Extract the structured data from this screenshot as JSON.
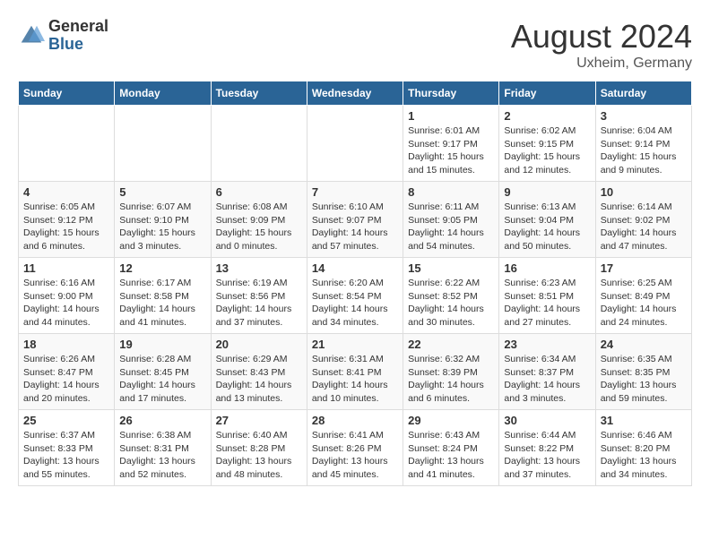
{
  "header": {
    "logo_general": "General",
    "logo_blue": "Blue",
    "month_year": "August 2024",
    "location": "Uxheim, Germany"
  },
  "days_of_week": [
    "Sunday",
    "Monday",
    "Tuesday",
    "Wednesday",
    "Thursday",
    "Friday",
    "Saturday"
  ],
  "weeks": [
    [
      {
        "day": "",
        "info": ""
      },
      {
        "day": "",
        "info": ""
      },
      {
        "day": "",
        "info": ""
      },
      {
        "day": "",
        "info": ""
      },
      {
        "day": "1",
        "info": "Sunrise: 6:01 AM\nSunset: 9:17 PM\nDaylight: 15 hours and 15 minutes."
      },
      {
        "day": "2",
        "info": "Sunrise: 6:02 AM\nSunset: 9:15 PM\nDaylight: 15 hours and 12 minutes."
      },
      {
        "day": "3",
        "info": "Sunrise: 6:04 AM\nSunset: 9:14 PM\nDaylight: 15 hours and 9 minutes."
      }
    ],
    [
      {
        "day": "4",
        "info": "Sunrise: 6:05 AM\nSunset: 9:12 PM\nDaylight: 15 hours and 6 minutes."
      },
      {
        "day": "5",
        "info": "Sunrise: 6:07 AM\nSunset: 9:10 PM\nDaylight: 15 hours and 3 minutes."
      },
      {
        "day": "6",
        "info": "Sunrise: 6:08 AM\nSunset: 9:09 PM\nDaylight: 15 hours and 0 minutes."
      },
      {
        "day": "7",
        "info": "Sunrise: 6:10 AM\nSunset: 9:07 PM\nDaylight: 14 hours and 57 minutes."
      },
      {
        "day": "8",
        "info": "Sunrise: 6:11 AM\nSunset: 9:05 PM\nDaylight: 14 hours and 54 minutes."
      },
      {
        "day": "9",
        "info": "Sunrise: 6:13 AM\nSunset: 9:04 PM\nDaylight: 14 hours and 50 minutes."
      },
      {
        "day": "10",
        "info": "Sunrise: 6:14 AM\nSunset: 9:02 PM\nDaylight: 14 hours and 47 minutes."
      }
    ],
    [
      {
        "day": "11",
        "info": "Sunrise: 6:16 AM\nSunset: 9:00 PM\nDaylight: 14 hours and 44 minutes."
      },
      {
        "day": "12",
        "info": "Sunrise: 6:17 AM\nSunset: 8:58 PM\nDaylight: 14 hours and 41 minutes."
      },
      {
        "day": "13",
        "info": "Sunrise: 6:19 AM\nSunset: 8:56 PM\nDaylight: 14 hours and 37 minutes."
      },
      {
        "day": "14",
        "info": "Sunrise: 6:20 AM\nSunset: 8:54 PM\nDaylight: 14 hours and 34 minutes."
      },
      {
        "day": "15",
        "info": "Sunrise: 6:22 AM\nSunset: 8:52 PM\nDaylight: 14 hours and 30 minutes."
      },
      {
        "day": "16",
        "info": "Sunrise: 6:23 AM\nSunset: 8:51 PM\nDaylight: 14 hours and 27 minutes."
      },
      {
        "day": "17",
        "info": "Sunrise: 6:25 AM\nSunset: 8:49 PM\nDaylight: 14 hours and 24 minutes."
      }
    ],
    [
      {
        "day": "18",
        "info": "Sunrise: 6:26 AM\nSunset: 8:47 PM\nDaylight: 14 hours and 20 minutes."
      },
      {
        "day": "19",
        "info": "Sunrise: 6:28 AM\nSunset: 8:45 PM\nDaylight: 14 hours and 17 minutes."
      },
      {
        "day": "20",
        "info": "Sunrise: 6:29 AM\nSunset: 8:43 PM\nDaylight: 14 hours and 13 minutes."
      },
      {
        "day": "21",
        "info": "Sunrise: 6:31 AM\nSunset: 8:41 PM\nDaylight: 14 hours and 10 minutes."
      },
      {
        "day": "22",
        "info": "Sunrise: 6:32 AM\nSunset: 8:39 PM\nDaylight: 14 hours and 6 minutes."
      },
      {
        "day": "23",
        "info": "Sunrise: 6:34 AM\nSunset: 8:37 PM\nDaylight: 14 hours and 3 minutes."
      },
      {
        "day": "24",
        "info": "Sunrise: 6:35 AM\nSunset: 8:35 PM\nDaylight: 13 hours and 59 minutes."
      }
    ],
    [
      {
        "day": "25",
        "info": "Sunrise: 6:37 AM\nSunset: 8:33 PM\nDaylight: 13 hours and 55 minutes."
      },
      {
        "day": "26",
        "info": "Sunrise: 6:38 AM\nSunset: 8:31 PM\nDaylight: 13 hours and 52 minutes."
      },
      {
        "day": "27",
        "info": "Sunrise: 6:40 AM\nSunset: 8:28 PM\nDaylight: 13 hours and 48 minutes."
      },
      {
        "day": "28",
        "info": "Sunrise: 6:41 AM\nSunset: 8:26 PM\nDaylight: 13 hours and 45 minutes."
      },
      {
        "day": "29",
        "info": "Sunrise: 6:43 AM\nSunset: 8:24 PM\nDaylight: 13 hours and 41 minutes."
      },
      {
        "day": "30",
        "info": "Sunrise: 6:44 AM\nSunset: 8:22 PM\nDaylight: 13 hours and 37 minutes."
      },
      {
        "day": "31",
        "info": "Sunrise: 6:46 AM\nSunset: 8:20 PM\nDaylight: 13 hours and 34 minutes."
      }
    ]
  ]
}
